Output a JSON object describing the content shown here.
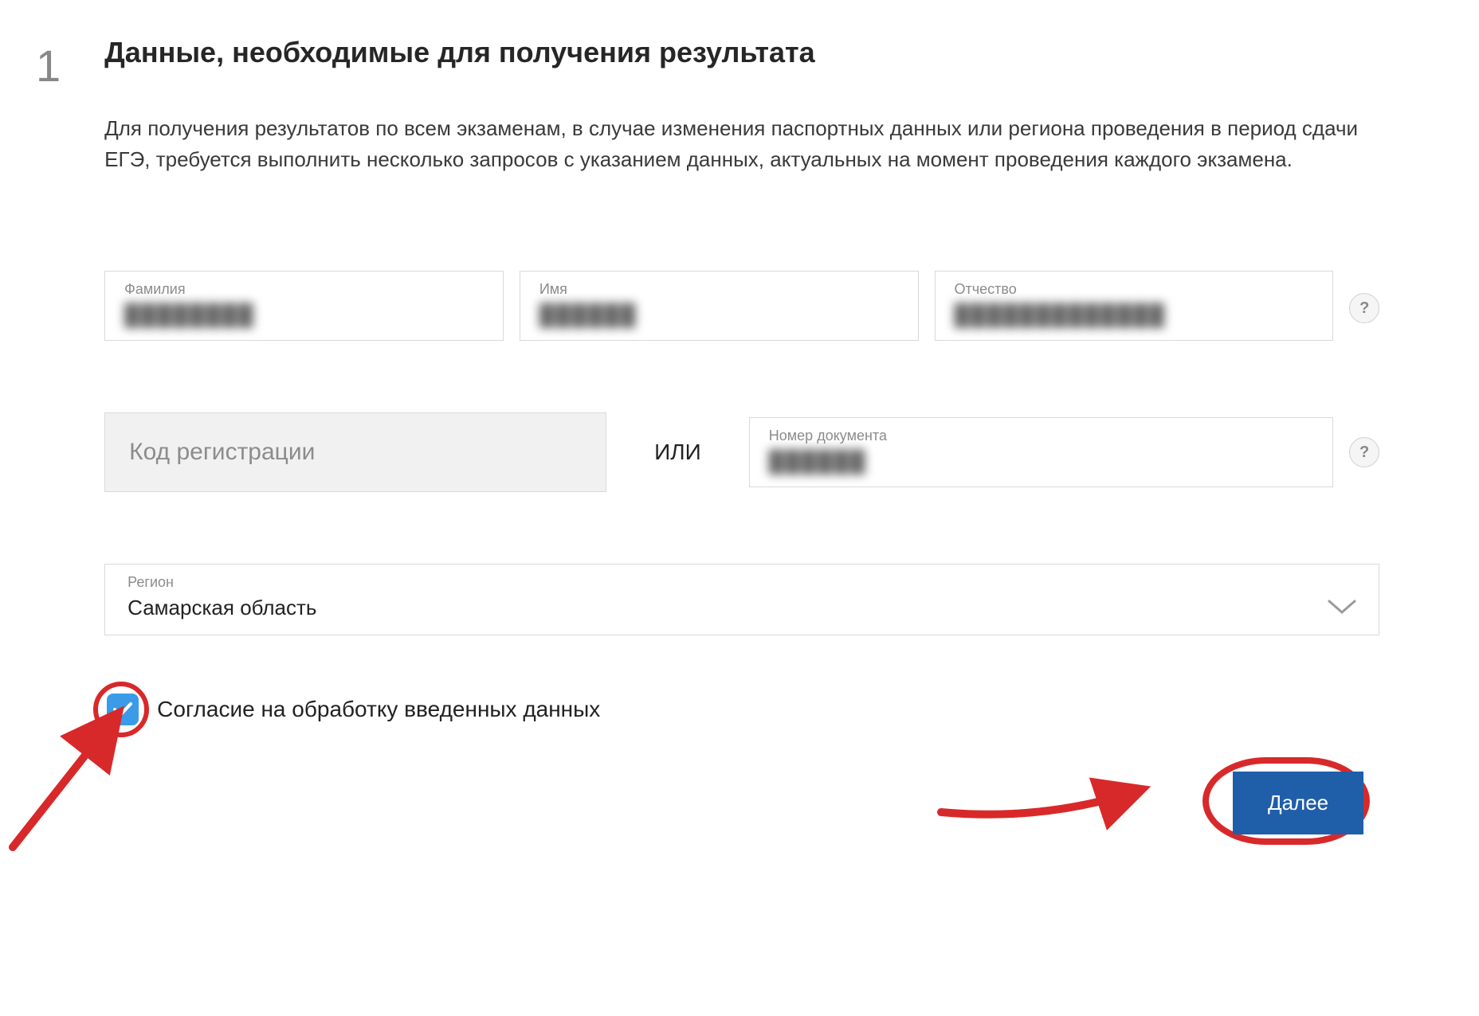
{
  "step": "1",
  "title": "Данные, необходимые для получения результата",
  "description": "Для получения результатов по всем экзаменам, в случае изменения паспортных данных или региона проведения в период сдачи ЕГЭ, требуется выполнить несколько запросов с указанием данных, актуальных на момент проведения каждого экзамена.",
  "fields": {
    "surname": {
      "label": "Фамилия"
    },
    "name": {
      "label": "Имя"
    },
    "patronymic": {
      "label": "Отчество"
    },
    "registration": {
      "placeholder": "Код регистрации"
    },
    "doc_number": {
      "label": "Номер документа"
    },
    "region": {
      "label": "Регион",
      "value": "Самарская область"
    }
  },
  "or_text": "ИЛИ",
  "consent_text": "Согласие на обработку введенных данных",
  "next_button": "Далее",
  "help_glyph": "?"
}
